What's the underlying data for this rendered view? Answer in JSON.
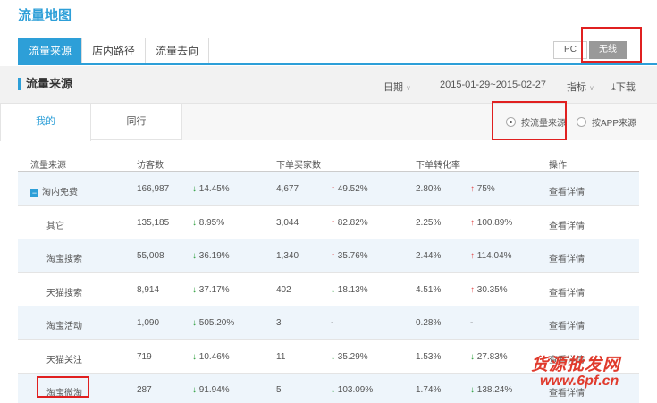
{
  "page_title": "流量地图",
  "tabs": [
    {
      "label": "流量来源",
      "active": true
    },
    {
      "label": "店内路径",
      "active": false
    },
    {
      "label": "流量去向",
      "active": false
    }
  ],
  "device": {
    "pc": "PC",
    "wireless": "无线",
    "selected": "无线"
  },
  "section": {
    "title": "流量来源",
    "date_label": "日期",
    "date_range": "2015-01-29~2015-02-27",
    "metric_label": "指标",
    "download_label": "下载"
  },
  "subtabs": {
    "mine": "我的",
    "peers": "同行"
  },
  "source_mode": {
    "by_flow": "按流量来源",
    "by_app": "按APP来源",
    "selected": "按流量来源"
  },
  "table": {
    "headers": {
      "source": "流量来源",
      "visitors": "访客数",
      "buyers": "下单买家数",
      "conversion": "下单转化率",
      "action": "操作"
    },
    "rows": [
      {
        "name": "淘内免费",
        "group": true,
        "visitors": "166,987",
        "visitors_change": "14.45%",
        "visitors_dir": "down",
        "buyers": "4,677",
        "buyers_change": "49.52%",
        "buyers_dir": "up",
        "rate": "2.80%",
        "rate_change": "75%",
        "rate_dir": "up",
        "action": "查看详情"
      },
      {
        "name": "其它",
        "visitors": "135,185",
        "visitors_change": "8.95%",
        "visitors_dir": "down",
        "buyers": "3,044",
        "buyers_change": "82.82%",
        "buyers_dir": "up",
        "rate": "2.25%",
        "rate_change": "100.89%",
        "rate_dir": "up",
        "action": "查看详情"
      },
      {
        "name": "淘宝搜索",
        "visitors": "55,008",
        "visitors_change": "36.19%",
        "visitors_dir": "down",
        "buyers": "1,340",
        "buyers_change": "35.76%",
        "buyers_dir": "up",
        "rate": "2.44%",
        "rate_change": "114.04%",
        "rate_dir": "up",
        "action": "查看详情"
      },
      {
        "name": "天猫搜索",
        "visitors": "8,914",
        "visitors_change": "37.17%",
        "visitors_dir": "down",
        "buyers": "402",
        "buyers_change": "18.13%",
        "buyers_dir": "down",
        "rate": "4.51%",
        "rate_change": "30.35%",
        "rate_dir": "up",
        "action": "查看详情"
      },
      {
        "name": "淘宝活动",
        "visitors": "1,090",
        "visitors_change": "505.20%",
        "visitors_dir": "down",
        "buyers": "3",
        "buyers_change": "-",
        "buyers_dir": "none",
        "rate": "0.28%",
        "rate_change": "-",
        "rate_dir": "none",
        "action": "查看详情"
      },
      {
        "name": "天猫关注",
        "visitors": "719",
        "visitors_change": "10.46%",
        "visitors_dir": "down",
        "buyers": "11",
        "buyers_change": "35.29%",
        "buyers_dir": "down",
        "rate": "1.53%",
        "rate_change": "27.83%",
        "rate_dir": "down",
        "action": "查看详情"
      },
      {
        "name": "淘宝微淘",
        "visitors": "287",
        "visitors_change": "91.94%",
        "visitors_dir": "down",
        "buyers": "5",
        "buyers_change": "103.09%",
        "buyers_dir": "down",
        "rate": "1.74%",
        "rate_change": "138.24%",
        "rate_dir": "down",
        "action": "查看详情"
      }
    ]
  },
  "watermark": {
    "line1": "货源批发网",
    "line2": "www.6pf.cn"
  },
  "colors": {
    "accent": "#2d9fd8",
    "up": "#e05050",
    "down": "#2a9d3a",
    "highlight": "#e02020"
  }
}
